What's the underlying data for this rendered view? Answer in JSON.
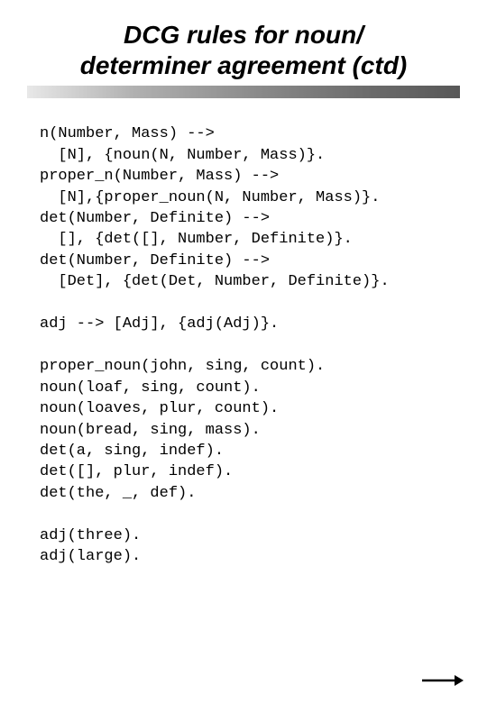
{
  "title_line1": "DCG rules for noun/",
  "title_line2": "determiner agreement (ctd)",
  "code": "n(Number, Mass) -->\n  [N], {noun(N, Number, Mass)}.\nproper_n(Number, Mass) -->\n  [N],{proper_noun(N, Number, Mass)}.\ndet(Number, Definite) -->\n  [], {det([], Number, Definite)}.\ndet(Number, Definite) -->\n  [Det], {det(Det, Number, Definite)}.\n\nadj --> [Adj], {adj(Adj)}.\n\nproper_noun(john, sing, count).\nnoun(loaf, sing, count).\nnoun(loaves, plur, count).\nnoun(bread, sing, mass).\ndet(a, sing, indef).\ndet([], plur, indef).\ndet(the, _, def).\n\nadj(three).\nadj(large).",
  "arrow_name": "next-arrow-icon"
}
